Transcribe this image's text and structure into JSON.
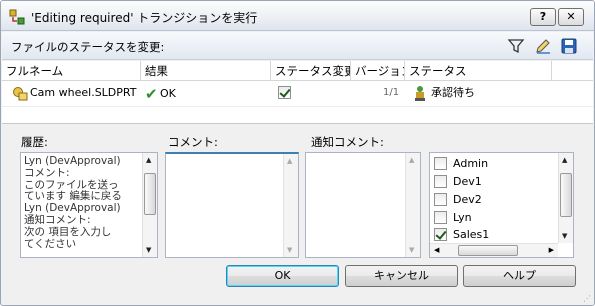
{
  "window": {
    "title": "'Editing required' トランジションを実行",
    "controls": {
      "help": "?",
      "close": "✕"
    }
  },
  "panel": {
    "header": "ファイルのステータスを変更:",
    "tools": [
      "filter-icon",
      "edit-icon",
      "save-icon"
    ]
  },
  "grid": {
    "columns": [
      "フルネーム",
      "結果",
      "ステータス変更",
      "バージョン",
      "ステータス"
    ],
    "rows": [
      {
        "name": "Cam wheel.SLDPRT",
        "result": "OK",
        "status_change": true,
        "version": "1/1",
        "status": "承認待ち"
      }
    ]
  },
  "history": {
    "label": "履歴:",
    "text": "Lyn (DevApproval)\nコメント:\nこのファイルを送っ\nています 編集に戻る\nLyn (DevApproval)\n通知コメント:\n次の 項目を入力し\nてください"
  },
  "comment": {
    "label": "コメント:",
    "value": ""
  },
  "notify": {
    "label": "通知コメント:",
    "value": "",
    "users": [
      {
        "name": "Admin",
        "checked": false
      },
      {
        "name": "Dev1",
        "checked": false
      },
      {
        "name": "Dev2",
        "checked": false
      },
      {
        "name": "Lyn",
        "checked": false
      },
      {
        "name": "Sales1",
        "checked": true
      }
    ]
  },
  "buttons": {
    "ok": "OK",
    "cancel": "キャンセル",
    "help": "ヘルプ"
  },
  "colors": {
    "check_green": "#2f8f2f",
    "title_bg": "#dfe5ee",
    "accent": "#3c7fb1"
  }
}
